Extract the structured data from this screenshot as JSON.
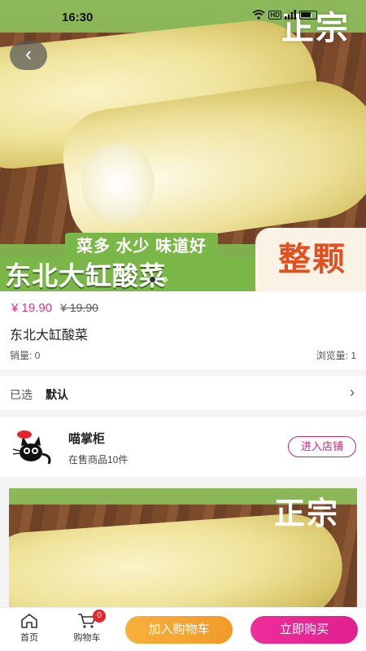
{
  "status_bar": {
    "time": "16:30",
    "network_badge": "HD",
    "battery_text": "77"
  },
  "hero": {
    "brand_text": "正宗",
    "tagline": "菜多 水少 味道好",
    "product_banner_title": "东北大缸酸菜",
    "banner_badge": "整颗",
    "carousel": {
      "total": 2,
      "active_index": 0
    }
  },
  "product": {
    "price": "¥ 19.90",
    "original_price": "¥ 19.90",
    "name": "东北大缸酸菜",
    "sales": "销量: 0",
    "views": "浏览量: 1"
  },
  "spec": {
    "label": "已选",
    "value": "默认"
  },
  "shop": {
    "name": "喵掌柜",
    "product_count": "在售商品10件",
    "enter_button": "进入店铺"
  },
  "detail_image": {
    "brand_text": "正宗"
  },
  "bottom_bar": {
    "home_label": "首页",
    "cart_label": "购物车",
    "cart_badge": "0",
    "add_to_cart": "加入购物车",
    "buy_now": "立即购买"
  },
  "colors": {
    "price": "#e0337c",
    "shop_button": "#c02b77",
    "add_to_cart": "#f5a431",
    "buy_now": "#e8268f",
    "banner_green": "#7ab648"
  }
}
